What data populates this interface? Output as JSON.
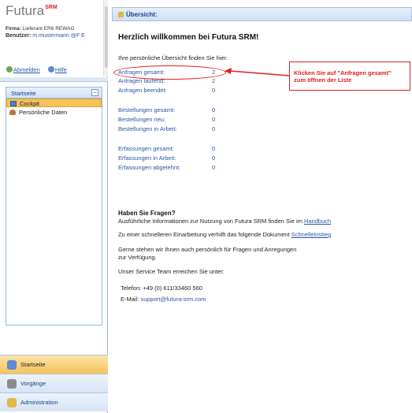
{
  "app": {
    "logo_text": "Futura",
    "logo_sup": "SRM",
    "firm_label": "Firma:",
    "firm_value": "Lieferant ER6  REWAG",
    "user_label": "Benutzer:",
    "user_value": "m.mustermann @F E",
    "logout_label": "Abmelden",
    "help_label": "Hilfe"
  },
  "sidebar": {
    "panel_title": "Startseite",
    "collapse_symbol": "–",
    "items": [
      {
        "label": "Cockpit",
        "icon": "cockpit-icon",
        "active": true
      },
      {
        "label": "Persönliche Daten",
        "icon": "person-icon",
        "active": false
      }
    ],
    "bottom_tabs": [
      {
        "label": "Startseite",
        "icon": "home-icon",
        "active": true
      },
      {
        "label": "Vorgänge",
        "icon": "process-icon",
        "active": false
      },
      {
        "label": "Administration",
        "icon": "admin-icon",
        "active": false
      }
    ]
  },
  "main": {
    "header_title": "Übersicht:",
    "welcome": "Herzlich willkommen bei Futura SRM!",
    "intro": "Ihre persönliche Übersicht finden Sie hier:",
    "stats": [
      {
        "label": "Anfragen gesamt:",
        "value": "2"
      },
      {
        "label": "Anfragen laufend:",
        "value": "2"
      },
      {
        "label": "Anfragen beendet:",
        "value": "0"
      },
      {
        "label": "Bestellungen gesamt:",
        "value": "0"
      },
      {
        "label": "Bestellungen neu:",
        "value": "0"
      },
      {
        "label": "Bestellungen in Arbeit:",
        "value": "0"
      },
      {
        "label": "Erfassungen gesamt:",
        "value": "0"
      },
      {
        "label": "Erfassungen in Arbeit:",
        "value": "0"
      },
      {
        "label": "Erfassungen abgelehnt:",
        "value": "0"
      }
    ],
    "callout_line1": "Klicken Sie auf \"Anfragen gesamt\"",
    "callout_line2": "zum öffnen der Liste",
    "help_title": "Haben Sie Fragen?",
    "help_line1": "Ausführliche Informationen zur Nutzung von Futura SRM finden Sie im",
    "help_link1": "Handbuch",
    "help_line2": "Zu einer schnelleren Einarbeitung verhilft das folgende Dokument",
    "help_link2": "Schnelleinstieg",
    "help_line3a": "Gerne stehen wir Ihnen auch persönlich für Fragen und Anregungen",
    "help_line3b": "zur Verfügung.",
    "help_line4": "Unser Service Team erreichen Sie unter:",
    "phone_label": "Telefon:",
    "phone_value": "+49 (0) 611/33460 560",
    "mail_label": "E-Mail:",
    "mail_value": "support@futura-srm.com"
  },
  "colors": {
    "accent_blue": "#2a56a8",
    "annotation_red": "#e02020",
    "active_orange": "#f7c25a"
  }
}
